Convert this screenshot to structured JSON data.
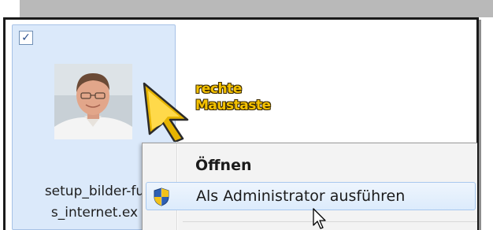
{
  "file": {
    "checkbox_mark": "✓",
    "name_line1": "setup_bilder-fu",
    "name_line2": "s_internet.ex"
  },
  "callout": {
    "line1": "rechte",
    "line2": "Maustaste",
    "color": "#f5c200"
  },
  "context_menu": {
    "items": [
      {
        "label": "Öffnen",
        "icon": ""
      },
      {
        "label": "Als Administrator ausführen",
        "icon": "uac-shield-icon",
        "highlighted": true
      }
    ]
  },
  "colors": {
    "selection_bg": "#dbe9fa",
    "menu_bg": "#f3f3f3",
    "hover_border": "#a8c8ee"
  }
}
